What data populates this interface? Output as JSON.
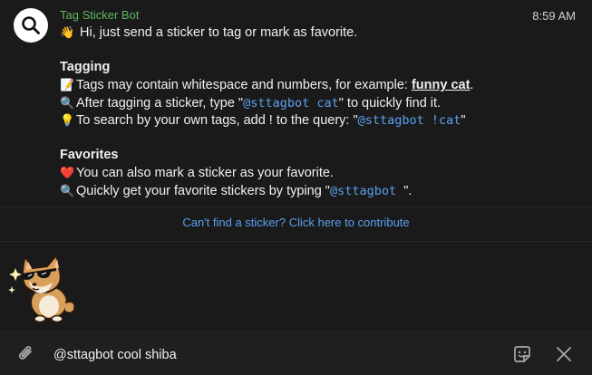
{
  "message": {
    "bot_name": "Tag Sticker Bot",
    "time": "8:59 AM",
    "greeting_emoji": "👋",
    "greeting": "Hi, just send a sticker to tag or mark as favorite.",
    "tagging": {
      "heading": "Tagging",
      "line1_emoji": "📝",
      "line1_text": "Tags may contain whitespace and numbers, for example: ",
      "line1_example": "funny cat",
      "line1_end": ".",
      "line2_emoji": "🔍",
      "line2_text": "After tagging a sticker, type \"",
      "line2_code": "@sttagbot cat",
      "line2_end": "\" to quickly find it.",
      "line3_emoji": "💡",
      "line3_text": "To search by your own tags, add ! to the query: \"",
      "line3_code": "@sttagbot !cat",
      "line3_end": "\""
    },
    "favorites": {
      "heading": "Favorites",
      "line1_emoji": "❤️",
      "line1_text": "You can also mark a sticker as your favorite.",
      "line2_emoji": "🔍",
      "line2_text": "Quickly get your favorite stickers by typing \"",
      "line2_code": "@sttagbot ",
      "line2_end": "\"."
    }
  },
  "contribute_link": "Can't find a sticker? Click here to contribute",
  "sticker_result": {
    "icon": "shiba-sunglasses-sticker"
  },
  "composer": {
    "input_value": "@sttagbot cool shiba",
    "attach_icon": "paperclip-icon",
    "sticker_icon": "sticker-icon",
    "close_icon": "close-icon"
  },
  "colors": {
    "background": "#1a1a1b",
    "bot_name": "#5fb55a",
    "link": "#5aa0ee"
  }
}
